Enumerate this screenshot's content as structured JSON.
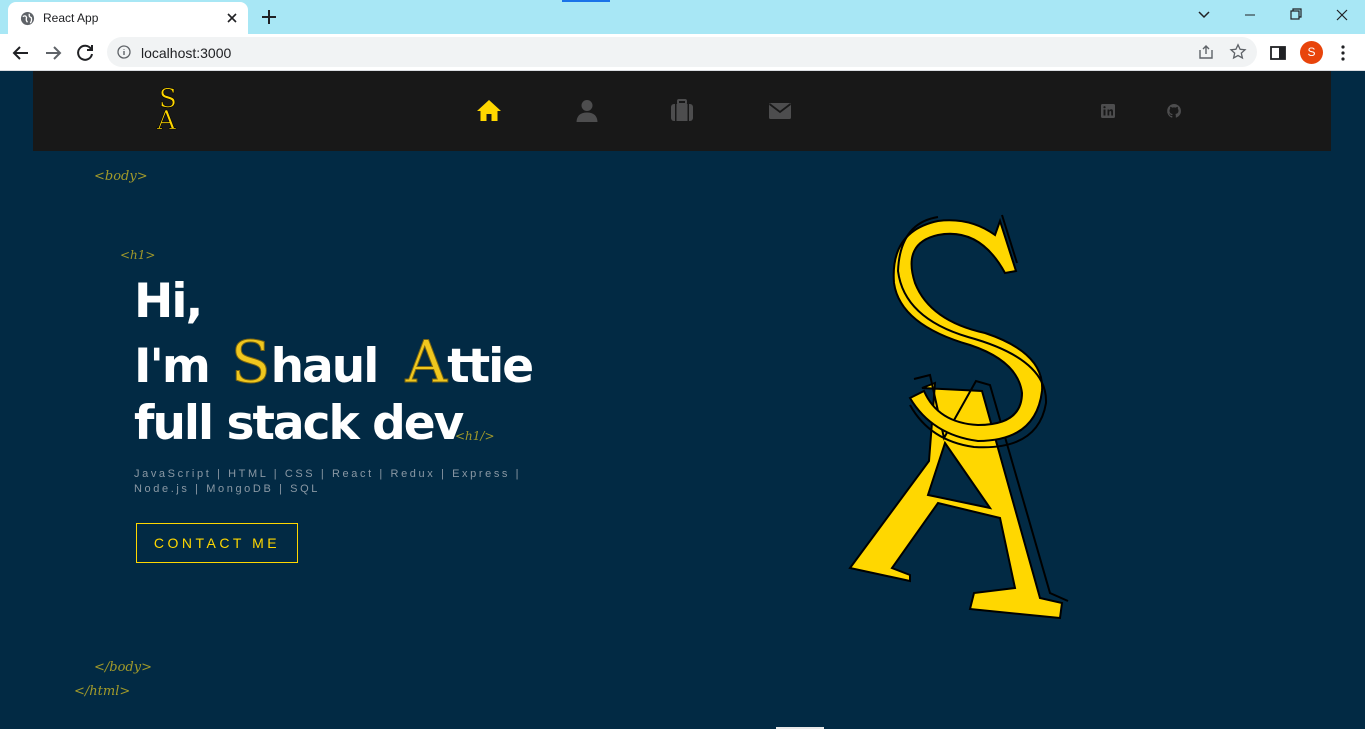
{
  "browser": {
    "tab_title": "React App",
    "url": "localhost:3000",
    "profile_initial": "S"
  },
  "colors": {
    "page_background": "#022a44",
    "navbar": "#181818",
    "accent": "#ffd700",
    "tag": "#a29a2a",
    "icon_inactive": "#4d4d4e"
  },
  "navbar": {
    "logo_alt": "SA logo",
    "icons": [
      "home-icon",
      "user-icon",
      "briefcase-icon",
      "envelope-icon"
    ],
    "active": "home",
    "social": [
      "linkedin-icon",
      "github-icon"
    ]
  },
  "tags": {
    "body_open": "<body>",
    "h1_open": "<h1>",
    "h1_close": "<h1/>",
    "body_close": "</body>",
    "html_close": "</html>"
  },
  "hero": {
    "line1": "Hi,",
    "line2_prefix": "I'm",
    "first_initial": "S",
    "first_rest": "haul",
    "last_initial": "A",
    "last_rest": "ttie",
    "line3": "full stack dev"
  },
  "skills": "JavaScript | HTML | CSS | React | Redux | Express | Node.js | MongoDB | SQL",
  "contact_button": "CONTACT ME"
}
